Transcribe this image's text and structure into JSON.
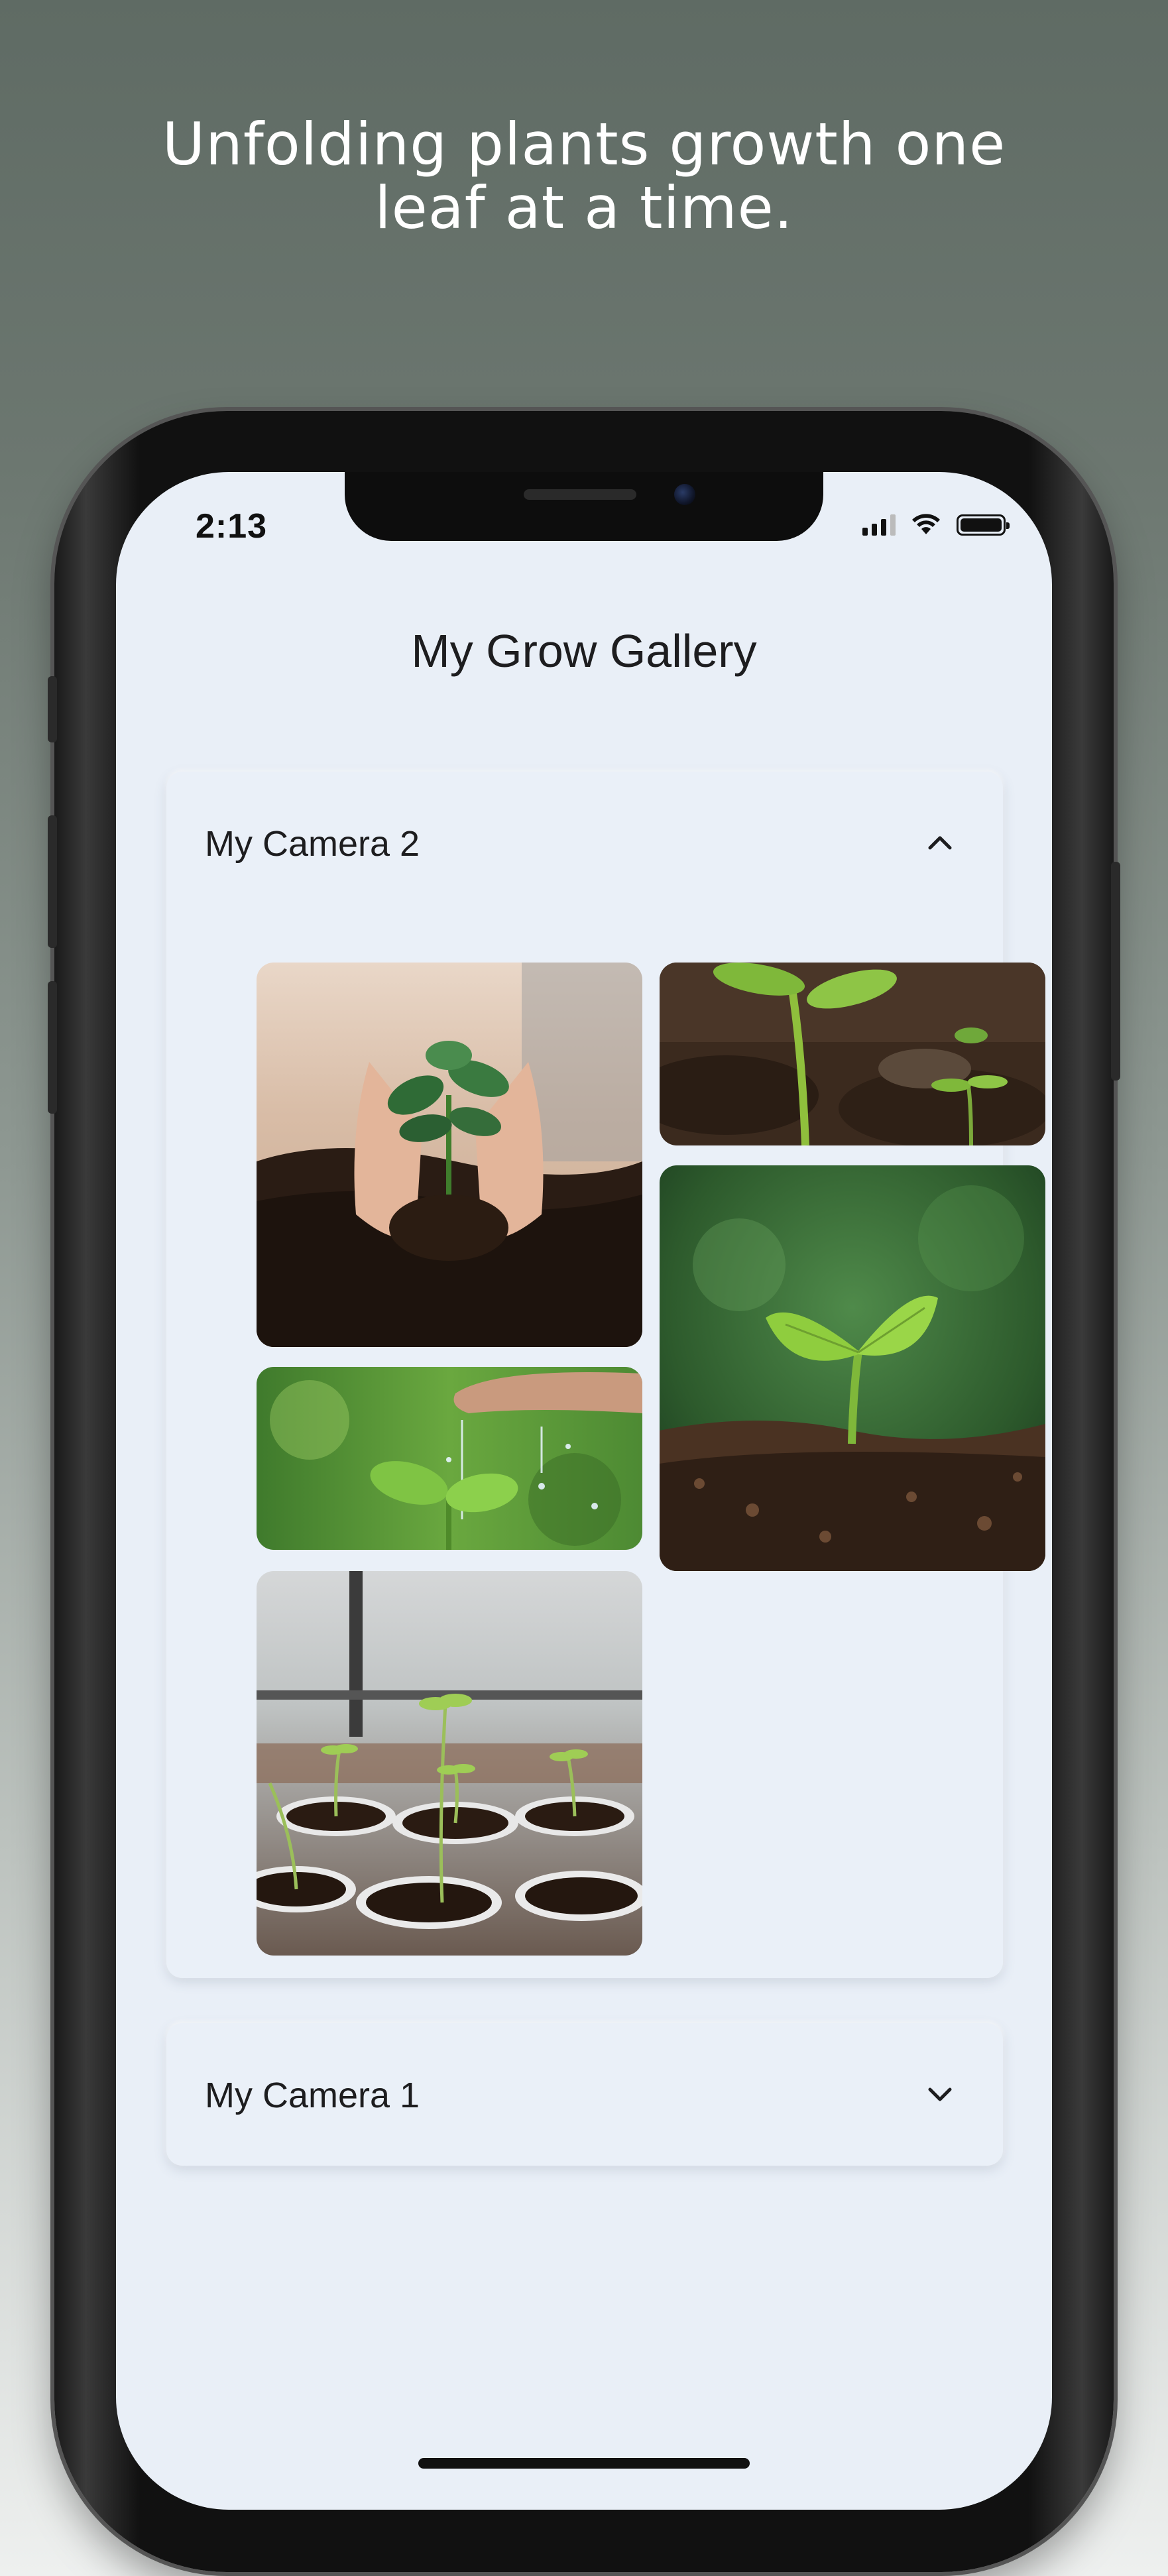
{
  "headline": {
    "line1": "Unfolding plants growth one",
    "line2": "leaf at a time."
  },
  "status_bar": {
    "time": "2:13",
    "icons": [
      "signal-icon",
      "wifi-icon",
      "battery-icon"
    ]
  },
  "page": {
    "title": "My Grow Gallery"
  },
  "galleries": [
    {
      "title": "My Camera 2",
      "expanded": true,
      "toggle_icon": "chevron-up-icon",
      "photos": [
        "hands-holding-seedling-in-soil",
        "young-sprout-in-soil",
        "seedling-with-two-leaves",
        "seedling-being-watered",
        "seedlings-in-pots-by-window"
      ]
    },
    {
      "title": "My Camera 1",
      "expanded": false,
      "toggle_icon": "chevron-down-icon"
    }
  ],
  "colors": {
    "screen_background": "#e9eff7",
    "card_background": "#eaf0f8",
    "text": "#1d1d1f",
    "plant_green": "#5fae3a"
  }
}
